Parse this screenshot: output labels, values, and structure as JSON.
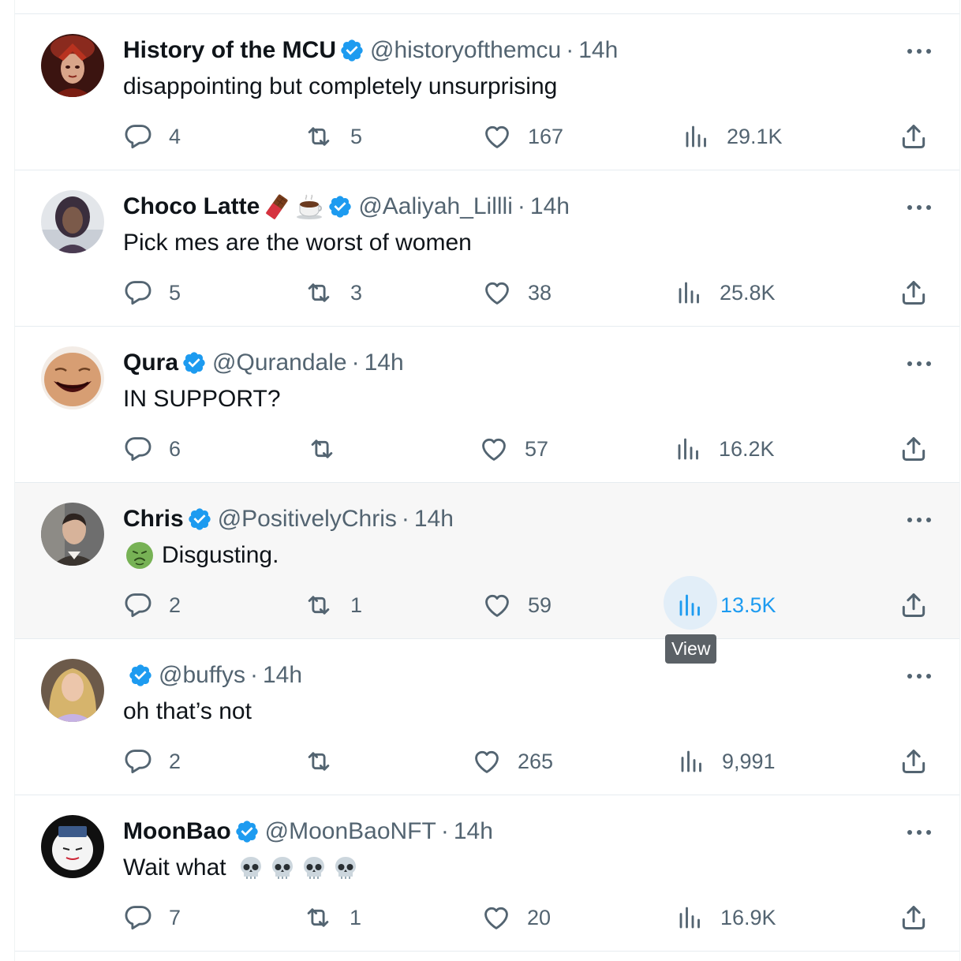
{
  "colors": {
    "accent": "#1d9bf0",
    "muted": "#536471",
    "verified": "#1d9bf0",
    "hover_bg": "#f7f7f7",
    "tooltip_bg": "#5b6166"
  },
  "icons": {
    "reply": "speech-bubble-icon",
    "retweet": "retweet-arrows-icon",
    "like": "heart-icon",
    "views": "bar-chart-icon",
    "share": "upload-share-icon",
    "more": "more-dots-icon",
    "verified": "verified-check-badge-icon"
  },
  "tweets": [
    {
      "name": "History of the MCU",
      "handle": "@historyofthemcu",
      "time": "14h",
      "text": "disappointing but completely unsurprising",
      "replies": "4",
      "retweets": "5",
      "likes": "167",
      "views": "29.1K"
    },
    {
      "name": "Choco Latte",
      "name_emojis": [
        "chocolate-bar-emoji",
        "hot-chocolate-emoji"
      ],
      "handle": "@Aaliyah_Lillli",
      "time": "14h",
      "text": "Pick mes are the worst of women",
      "replies": "5",
      "retweets": "3",
      "likes": "38",
      "views": "25.8K"
    },
    {
      "name": "Qura",
      "handle": "@Qurandale",
      "time": "14h",
      "text": "IN SUPPORT?",
      "replies": "6",
      "retweets": "",
      "likes": "57",
      "views": "16.2K"
    },
    {
      "name": "Chris",
      "handle": "@PositivelyChris",
      "time": "14h",
      "text_emoji": "nauseated-face-emoji",
      "text": "Disgusting.",
      "replies": "2",
      "retweets": "1",
      "likes": "59",
      "views": "13.5K",
      "hovered": true,
      "tooltip": "View"
    },
    {
      "name": "",
      "handle": "@buffys",
      "time": "14h",
      "text": "oh that’s not",
      "replies": "2",
      "retweets": "",
      "likes": "265",
      "views": "9,991"
    },
    {
      "name": "MoonBao",
      "handle": "@MoonBaoNFT",
      "time": "14h",
      "text": "Wait what",
      "text_trailing_emojis": [
        "skull-emoji",
        "skull-emoji",
        "skull-emoji",
        "skull-emoji"
      ],
      "replies": "7",
      "retweets": "1",
      "likes": "20",
      "views": "16.9K"
    }
  ]
}
